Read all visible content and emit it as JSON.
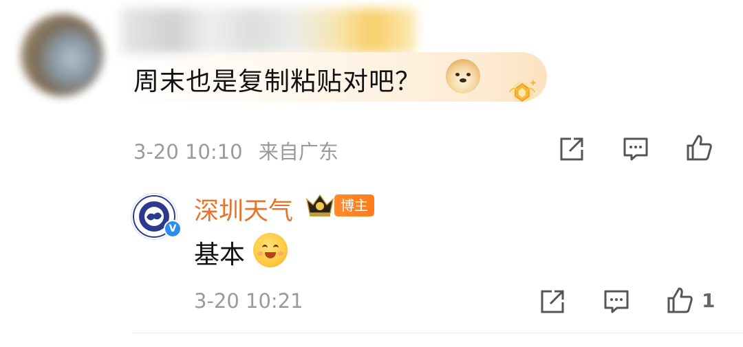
{
  "comment": {
    "text": "周末也是复制粘贴对吧？",
    "emoji_icon": "doge-icon",
    "badge_icon": "fan-badge-icon",
    "time": "3-20 10:10",
    "location": "来自广东",
    "actions": [
      "share-icon",
      "comment-icon",
      "like-icon"
    ]
  },
  "reply": {
    "author": "深圳天气",
    "author_color": "#E8732A",
    "author_tag": "博主",
    "verified_icon": "verified-v-icon",
    "crown_icon": "crown-icon",
    "text": "基本",
    "emoji_icon": "hug-smile-icon",
    "time": "3-20 10:21",
    "like_count": "1",
    "actions": [
      "share-icon",
      "comment-icon",
      "like-icon"
    ]
  },
  "colors": {
    "accent": "#FF7B1A",
    "meta_text": "#9A9A9A",
    "verified": "#2D8CF0"
  }
}
